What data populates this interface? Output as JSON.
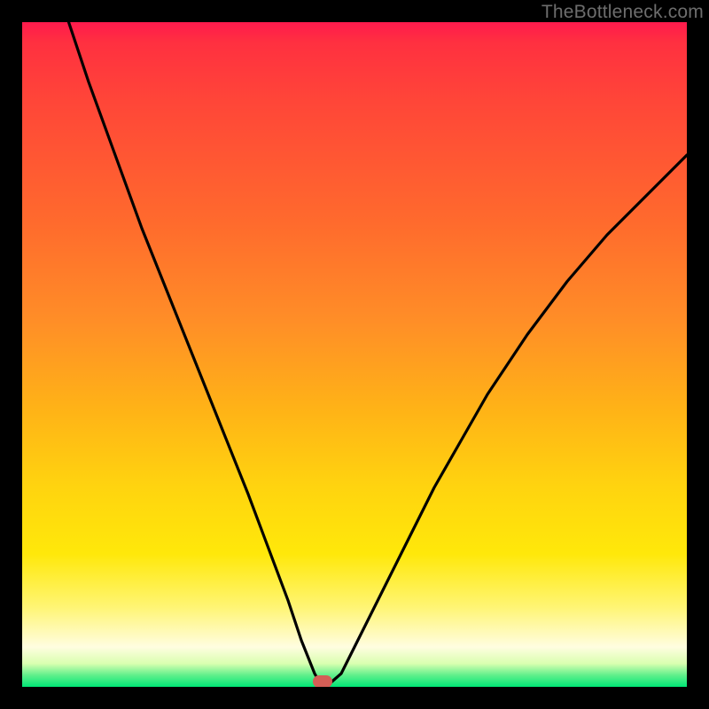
{
  "watermark": "TheBottleneck.com",
  "chart_data": {
    "type": "line",
    "title": "",
    "xlabel": "",
    "ylabel": "",
    "x_range": [
      0,
      100
    ],
    "y_range": [
      0,
      100
    ],
    "grid": false,
    "legend": false,
    "description": "Bottleneck V-curve: steep descent from top-left reaching a minimum near x≈45, then rising to the right with decreasing slope. Background encodes severity by vertical gradient (red=top=bad, green=bottom=good).",
    "series": [
      {
        "name": "bottleneck-curve",
        "x": [
          7,
          10,
          14,
          18,
          22,
          26,
          30,
          34,
          37,
          40,
          42,
          44,
          45,
          46,
          48,
          50,
          54,
          58,
          62,
          66,
          70,
          76,
          82,
          88,
          94,
          100
        ],
        "y": [
          100,
          91,
          80,
          69,
          59,
          49,
          39,
          29,
          21,
          13,
          7,
          2,
          0,
          0,
          2,
          6,
          14,
          22,
          30,
          37,
          44,
          53,
          61,
          68,
          74,
          80
        ]
      }
    ],
    "marker": {
      "x": 45.3,
      "y": 0.8,
      "color": "#d45e56"
    },
    "gradient_stops": [
      {
        "pos": 0,
        "color": "#ff1a4d"
      },
      {
        "pos": 0.3,
        "color": "#ff6a2d"
      },
      {
        "pos": 0.7,
        "color": "#ffd40f"
      },
      {
        "pos": 0.94,
        "color": "#fffde0"
      },
      {
        "pos": 1.0,
        "color": "#00e676"
      }
    ]
  }
}
